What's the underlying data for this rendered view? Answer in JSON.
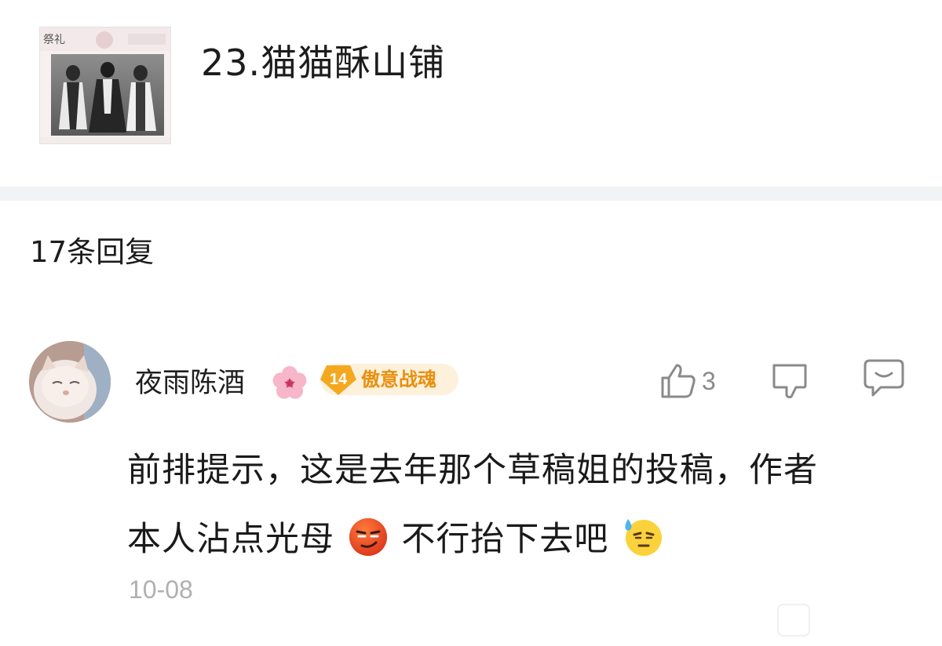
{
  "post": {
    "title": "23.猫猫酥山铺",
    "thumbnail_icon": "cosplay-thumbnail"
  },
  "replies": {
    "count_label": "17条回复"
  },
  "comment": {
    "username": "夜雨陈酒",
    "username_emoji": "cherry-blossom-icon",
    "level_number": "14",
    "level_title": "傲意战魂",
    "like_count": "3",
    "body_line1": "前排提示，这是去年那个草稿姐的投稿，作者",
    "body_line2_part1": "本人沾点光母",
    "body_line2_part2": "不行抬下去吧",
    "timestamp": "10-08"
  },
  "colors": {
    "badge_bg": "#fdf1dc",
    "badge_text": "#e8900f",
    "badge_shape": "#f4a81f",
    "icon_gray": "#8a8a8a",
    "timestamp": "#b0b0b0",
    "divider": "#f2f3f5"
  }
}
